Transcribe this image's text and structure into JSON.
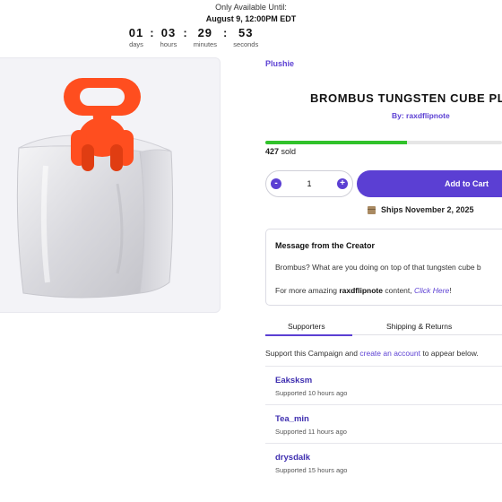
{
  "countdown": {
    "label": "Only Available Until:",
    "date": "August 9, 12:00PM EDT",
    "units": [
      {
        "value": "01",
        "label": "days"
      },
      {
        "value": "03",
        "label": "hours"
      },
      {
        "value": "29",
        "label": "minutes"
      },
      {
        "value": "53",
        "label": "seconds"
      }
    ],
    "separator": ":"
  },
  "product": {
    "category": "Plushie",
    "title": "BROMBUS TUNGSTEN CUBE PLU",
    "creator_line": "By: raxdflipnote",
    "progress_fraction": 0.6,
    "progress_color": "#31c22b",
    "sold": "427",
    "sold_suffix": "sold",
    "quantity": "1",
    "minus_label": "-",
    "plus_label": "+",
    "add_to_cart": "Add to Cart",
    "ships": "Ships November 2, 2025",
    "accent_color": "#5b3fd3"
  },
  "message": {
    "title": "Message from the Creator",
    "body": "Brombus? What are you doing on top of that tungsten cube b",
    "more_prefix": "For more amazing",
    "more_creator": "raxdflipnote",
    "more_middle": "content,",
    "more_link": "Click Here",
    "more_suffix": "!"
  },
  "tabs": [
    {
      "label": "Supporters",
      "active": true
    },
    {
      "label": "Shipping & Returns",
      "active": false
    }
  ],
  "support_note": {
    "prefix": "Support this Campaign and",
    "link": "create an account",
    "suffix": "to appear below."
  },
  "supporters": [
    {
      "name": "Eaksksm",
      "time": "Supported 10 hours ago"
    },
    {
      "name": "Tea_min",
      "time": "Supported 11 hours ago"
    },
    {
      "name": "drysdalk",
      "time": "Supported 15 hours ago"
    }
  ]
}
